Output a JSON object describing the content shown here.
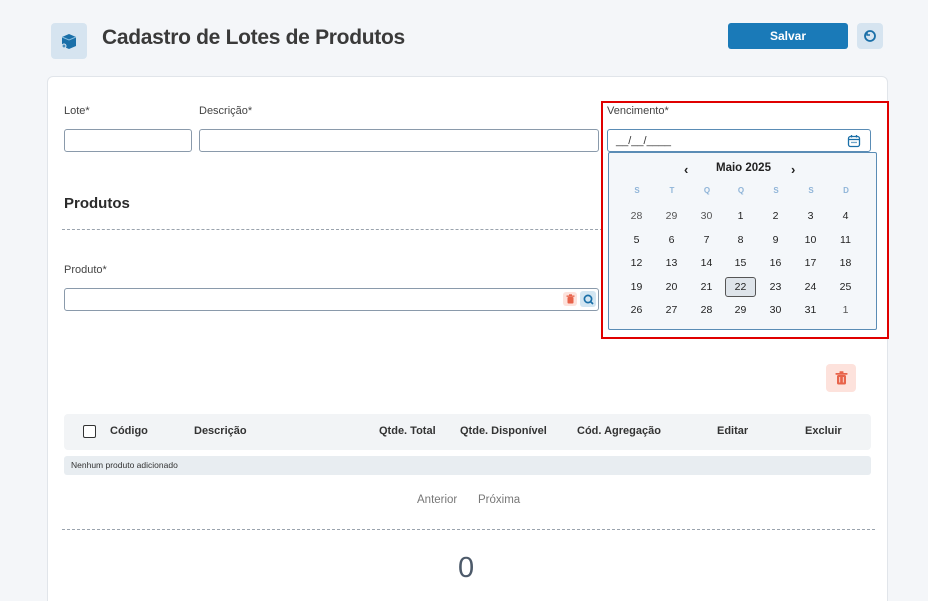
{
  "header": {
    "title": "Cadastro de Lotes de Produtos",
    "save_label": "Salvar",
    "icon": "box-icon",
    "back_icon": "undo-icon"
  },
  "form": {
    "lote_label": "Lote*",
    "lote_value": "",
    "descricao_label": "Descrição*",
    "descricao_value": "",
    "vencimento_label": "Vencimento*",
    "vencimento_value": "__/__/____"
  },
  "products": {
    "section_title": "Produtos",
    "produto_label": "Produto*",
    "produto_value": ""
  },
  "calendar": {
    "month_label": "Maio 2025",
    "prev": "‹",
    "next": "›",
    "weekdays": [
      "S",
      "T",
      "Q",
      "Q",
      "S",
      "S",
      "D"
    ],
    "weeks": [
      [
        "28",
        "29",
        "30",
        "1",
        "2",
        "3",
        "4"
      ],
      [
        "5",
        "6",
        "7",
        "8",
        "9",
        "10",
        "11"
      ],
      [
        "12",
        "13",
        "14",
        "15",
        "16",
        "17",
        "18"
      ],
      [
        "19",
        "20",
        "21",
        "22",
        "23",
        "24",
        "25"
      ],
      [
        "26",
        "27",
        "28",
        "29",
        "30",
        "31",
        "1"
      ]
    ],
    "selected_day": "22"
  },
  "table": {
    "columns": [
      "Código",
      "Descrição",
      "Qtde. Total",
      "Qtde. Disponível",
      "Cód. Agregação",
      "Editar",
      "Excluir"
    ],
    "empty_message": "Nenhum produto adicionado"
  },
  "pagination": {
    "prev_label": "Anterior",
    "next_label": "Próxima"
  },
  "total": "0",
  "colors": {
    "primary": "#1a7ab8",
    "danger_bg": "#fde2dc",
    "danger": "#e8634a",
    "highlight": "#e00000"
  }
}
